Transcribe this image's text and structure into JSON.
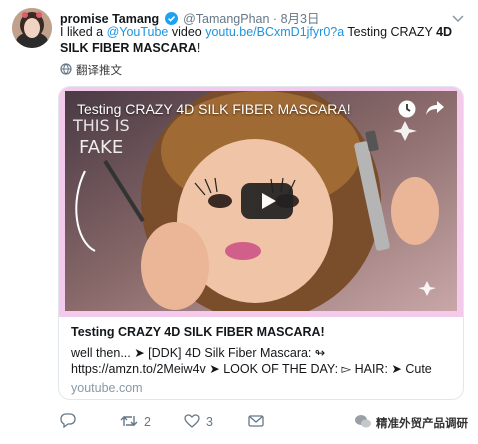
{
  "author": {
    "name": "promise Tamang",
    "handle": "@TamangPhan",
    "separator": "·",
    "date": "8月3日"
  },
  "tweet": {
    "prefix": "I liked a ",
    "mention": "@YouTube",
    "middle": " video ",
    "url": "youtu.be/BCxmD1jfyr0?a",
    "title_plain": " Testing CRAZY ",
    "title_bold": "4D SILK FIBER MASCARA",
    "suffix": "!"
  },
  "translate_label": "翻译推文",
  "video": {
    "overlay_title": "Testing CRAZY 4D SILK FIBER MASCARA!",
    "handwritten_text": "THIS IS FAKE"
  },
  "card": {
    "title": "Testing CRAZY 4D SILK FIBER MASCARA!",
    "description": "well then... ➤ [DDK] 4D Silk Fiber Mascara: ↬\nhttps://amzn.to/2Meiw4v ➤ LOOK OF THE DAY: ▻ HAIR: ➤ Cute Co...",
    "domain": "youtube.com"
  },
  "actions": {
    "retweet_count": "2",
    "like_count": "3"
  },
  "watermark": "精准外贸产品调研",
  "colors": {
    "link": "#1b95e0",
    "muted": "#657786",
    "media_border": "#f3c9ec"
  }
}
